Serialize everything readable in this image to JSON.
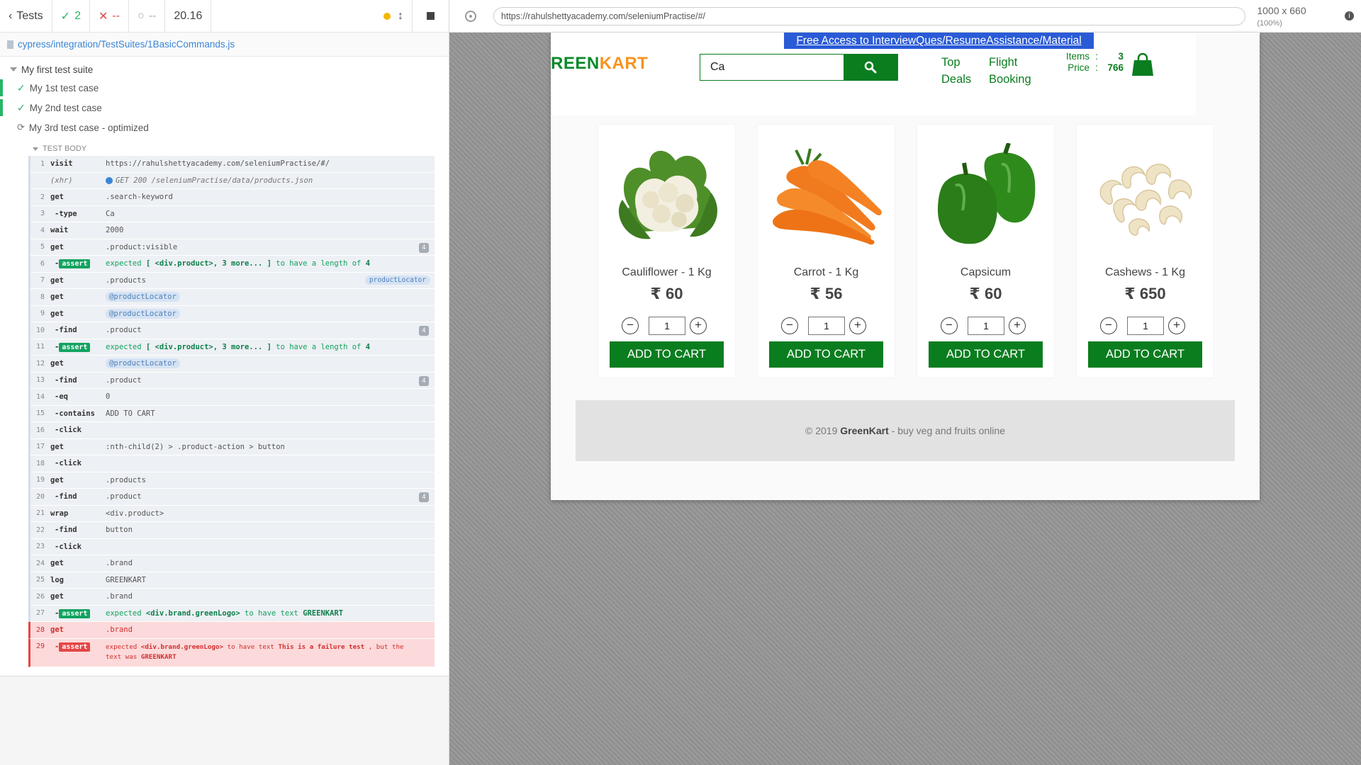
{
  "runner": {
    "back_label": "Tests",
    "passed_count": "2",
    "failed_count": "--",
    "pending_count": "--",
    "duration": "20.16",
    "spec_file": "cypress/integration/TestSuites/1BasicCommands.js",
    "suite_title": "My first test suite",
    "tests": [
      {
        "title": "My 1st test case"
      },
      {
        "title": "My 2nd test case"
      },
      {
        "title": "My 3rd test case - optimized"
      }
    ],
    "test_body_label": "TEST BODY",
    "commands": [
      {
        "num": "1",
        "name": "visit",
        "msg": "https://rahulshettyacademy.com/seleniumPractise/#/"
      },
      {
        "num": "",
        "name": "(xhr)",
        "msg": "GET 200 /seleniumPractise/data/products.json"
      },
      {
        "num": "2",
        "name": "get",
        "msg": ".search-keyword"
      },
      {
        "num": "3",
        "name": "-type",
        "msg": "Ca"
      },
      {
        "num": "4",
        "name": "wait",
        "msg": "2000"
      },
      {
        "num": "5",
        "name": "get",
        "msg": ".product:visible",
        "badge": "4"
      },
      {
        "num": "6",
        "name": "assert",
        "pre": "expected",
        "el": "[ <div.product>, 3 more... ]",
        "mid": "to have a length of",
        "val": "4"
      },
      {
        "num": "7",
        "name": "get",
        "msg": ".products",
        "alias": "productLocator"
      },
      {
        "num": "8",
        "name": "get",
        "msg": "@productLocator"
      },
      {
        "num": "9",
        "name": "get",
        "msg": "@productLocator"
      },
      {
        "num": "10",
        "name": "-find",
        "msg": ".product",
        "badge": "4"
      },
      {
        "num": "11",
        "name": "assert",
        "pre": "expected",
        "el": "[ <div.product>, 3 more... ]",
        "mid": "to have a length of",
        "val": "4"
      },
      {
        "num": "12",
        "name": "get",
        "msg": "@productLocator"
      },
      {
        "num": "13",
        "name": "-find",
        "msg": ".product",
        "badge": "4"
      },
      {
        "num": "14",
        "name": "-eq",
        "msg": "0"
      },
      {
        "num": "15",
        "name": "-contains",
        "msg": "ADD TO CART"
      },
      {
        "num": "16",
        "name": "-click",
        "msg": ""
      },
      {
        "num": "17",
        "name": "get",
        "msg": ":nth-child(2) > .product-action > button"
      },
      {
        "num": "18",
        "name": "-click",
        "msg": ""
      },
      {
        "num": "19",
        "name": "get",
        "msg": ".products"
      },
      {
        "num": "20",
        "name": "-find",
        "msg": ".product",
        "badge": "4"
      },
      {
        "num": "21",
        "name": "wrap",
        "msg": "<div.product>"
      },
      {
        "num": "22",
        "name": "-find",
        "msg": "button"
      },
      {
        "num": "23",
        "name": "-click",
        "msg": ""
      },
      {
        "num": "24",
        "name": "get",
        "msg": ".brand"
      },
      {
        "num": "25",
        "name": "log",
        "msg": "GREENKART"
      },
      {
        "num": "26",
        "name": "get",
        "msg": ".brand"
      },
      {
        "num": "27",
        "name": "assert",
        "pre": "expected",
        "el": "<div.brand.greenLogo>",
        "mid": "to have text",
        "val": "GREENKART"
      },
      {
        "num": "28",
        "name": "get",
        "msg": ".brand"
      },
      {
        "num": "29",
        "name": "assert",
        "pre": "expected",
        "el": "<div.brand.greenLogo>",
        "mid": "to have text",
        "val": "This is a failure test",
        "tail": ", but the",
        "line2": "text was",
        "actual": "GREENKART"
      }
    ]
  },
  "browser": {
    "url": "https://rahulshettyacademy.com/seleniumPractise/#/",
    "viewport": "1000 x 660",
    "scale": "(100%)"
  },
  "app": {
    "promo": "Free Access to InterviewQues/ResumeAssistance/Material",
    "brand_part1": "REEN",
    "brand_part2": "KART",
    "search_value": "Ca",
    "nav": {
      "top": "Top",
      "deals": "Deals",
      "flight": "Flight",
      "booking": "Booking"
    },
    "cart": {
      "items_label": "Items",
      "items_value": "3",
      "price_label": "Price",
      "price_value": "766",
      "separator": ":"
    },
    "products": [
      {
        "name": "Cauliflower - 1 Kg",
        "price": "₹ 60",
        "qty": "1",
        "button": "ADD TO CART",
        "image_icon": "cauliflower-image"
      },
      {
        "name": "Carrot - 1 Kg",
        "price": "₹ 56",
        "qty": "1",
        "button": "ADD TO CART",
        "image_icon": "carrot-image"
      },
      {
        "name": "Capsicum",
        "price": "₹ 60",
        "qty": "1",
        "button": "ADD TO CART",
        "image_icon": "capsicum-image"
      },
      {
        "name": "Cashews - 1 Kg",
        "price": "₹ 650",
        "qty": "1",
        "button": "ADD TO CART",
        "image_icon": "cashews-image"
      }
    ],
    "footer": {
      "prefix": "© 2019",
      "brand": "GreenKart",
      "suffix": "- buy veg and fruits online"
    }
  },
  "colors": {
    "green": "#0a7d1f",
    "pass": "#25b565",
    "fail": "#e54646",
    "kart_orange": "#f7931e"
  }
}
